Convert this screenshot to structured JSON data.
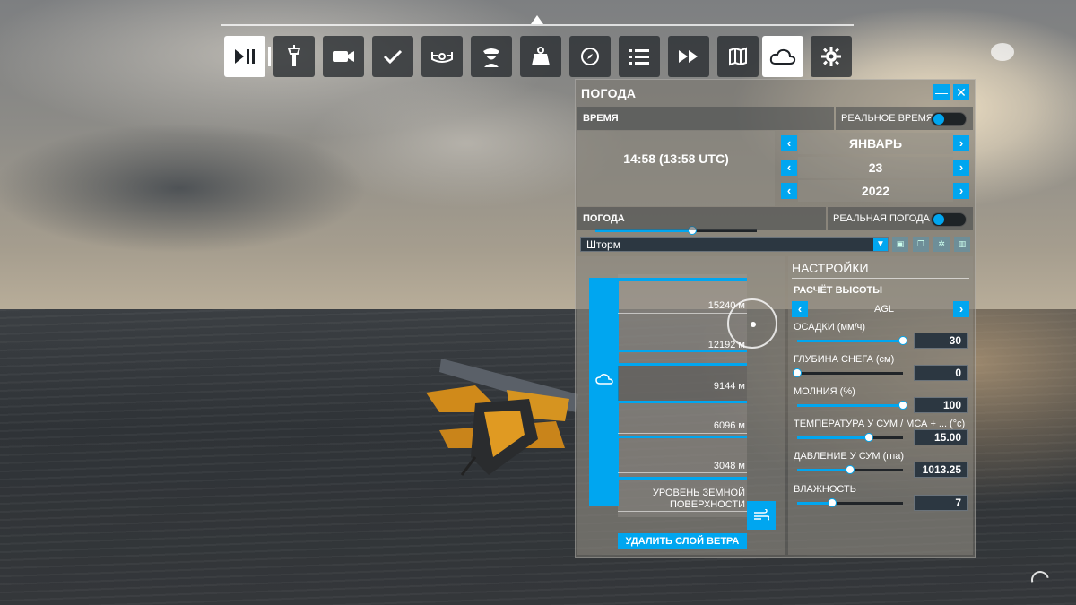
{
  "colors": {
    "accent": "#00a6f0",
    "field_bg": "#2c3741"
  },
  "toolbar": {
    "buttons": [
      {
        "icon": "pause-play-icon",
        "active": true
      },
      {
        "icon": "control-tower-icon"
      },
      {
        "icon": "camera-icon"
      },
      {
        "icon": "checklist-icon"
      },
      {
        "icon": "controls-icon"
      },
      {
        "icon": "pilot-icon"
      },
      {
        "icon": "weight-icon"
      },
      {
        "icon": "compass-icon"
      },
      {
        "icon": "list-icon"
      },
      {
        "icon": "fast-forward-icon"
      },
      {
        "icon": "map-icon"
      },
      {
        "icon": "cloud-icon",
        "active": true
      },
      {
        "icon": "settings-gear-icon"
      }
    ]
  },
  "panel": {
    "title": "ПОГОДА",
    "minimize_label": "—",
    "close_label": "✕",
    "time": {
      "section_label": "ВРЕМЯ",
      "real_time_label": "РЕАЛЬНОЕ ВРЕМЯ",
      "value": "14:58 (13:58 UTC)",
      "slider_fraction": 0.6,
      "month": "ЯНВАРЬ",
      "day": "23",
      "year": "2022"
    },
    "weather": {
      "section_label": "ПОГОДА",
      "real_weather_label": "РЕАЛЬНАЯ ПОГОДА",
      "preset": "Шторм"
    },
    "layers": {
      "altitudes": [
        "15240 м",
        "12192 м",
        "9144 м",
        "6096 м",
        "3048 м"
      ],
      "ground_label_1": "УРОВЕНЬ ЗЕМНОЙ",
      "ground_label_2": "ПОВЕРХНОСТИ",
      "delete_wind_label": "УДАЛИТЬ СЛОЙ ВЕТРА"
    },
    "settings": {
      "title": "НАСТРОЙКИ",
      "altitude_calc_label": "РАСЧЁТ ВЫСОТЫ",
      "altitude_calc_value": "AGL",
      "precipitation_label": "ОСАДКИ (мм/ч)",
      "precipitation_value": "30",
      "precipitation_fraction": 1.0,
      "snow_label": "ГЛУБИНА СНЕГА (см)",
      "snow_value": "0",
      "snow_fraction": 0.0,
      "lightning_label": "МОЛНИЯ (%)",
      "lightning_value": "100",
      "lightning_fraction": 1.0,
      "temperature_label": "ТЕМПЕРАТУРА У СУМ / МСА + ...",
      "temperature_unit": "(°с)",
      "temperature_value": "15.00",
      "temperature_fraction": 0.68,
      "pressure_label": "ДАВЛЕНИЕ У СУМ (гпа)",
      "pressure_value": "1013.25",
      "pressure_fraction": 0.5,
      "humidity_label": "ВЛАЖНОСТЬ",
      "humidity_value": "7",
      "humidity_fraction": 0.33
    }
  }
}
